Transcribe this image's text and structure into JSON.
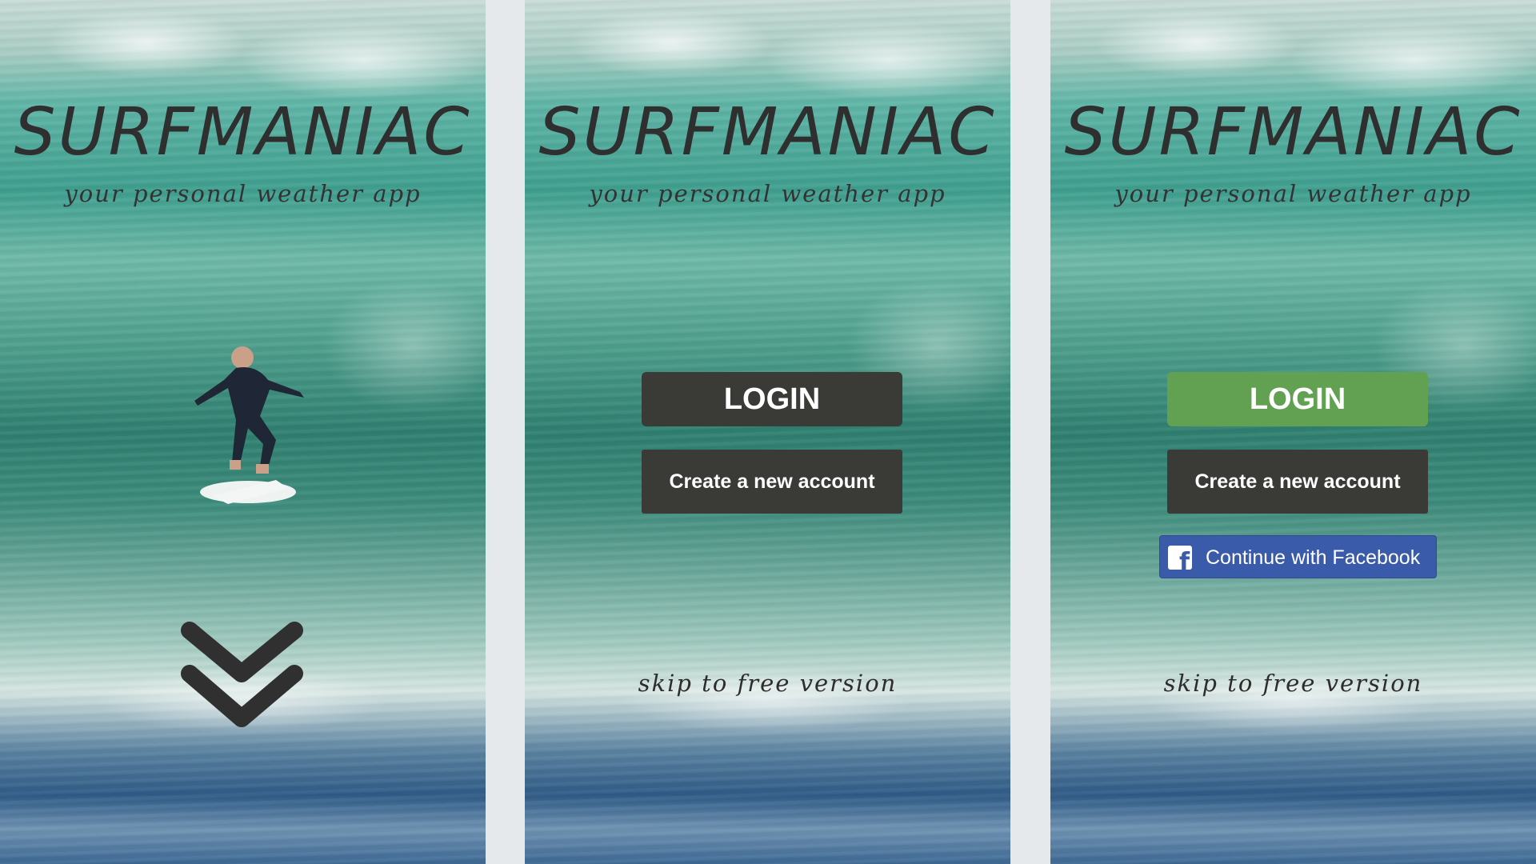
{
  "app": {
    "name": "SURFMANIAC",
    "tagline": "your personal weather app"
  },
  "screen1": {
    "scroll_icon": "double-chevron-down-icon"
  },
  "screen2": {
    "login_label": "LOGIN",
    "create_account_label": "Create a new account",
    "skip_label": "skip to free version"
  },
  "screen3": {
    "login_label": "LOGIN",
    "create_account_label": "Create a new account",
    "facebook_label": "Continue with Facebook",
    "facebook_icon": "facebook-icon",
    "skip_label": "skip to free version"
  },
  "colors": {
    "page_background": "#e6e9ec",
    "button_dark": "#3a3a37",
    "login_active_green": "#62a152",
    "facebook_blue": "#3a5ba9",
    "text_dark": "#2f2f2f"
  }
}
